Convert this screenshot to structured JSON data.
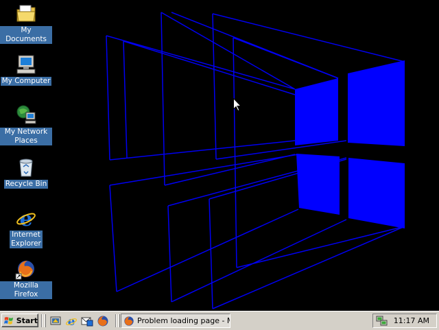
{
  "desktop": {
    "icons": [
      {
        "label": "My Documents",
        "icon": "my-documents-icon"
      },
      {
        "label": "My Computer",
        "icon": "my-computer-icon"
      },
      {
        "label": "My Network Places",
        "icon": "network-places-icon"
      },
      {
        "label": "Recycle Bin",
        "icon": "recycle-bin-icon"
      },
      {
        "label": "Internet Explorer",
        "icon": "internet-explorer-icon"
      },
      {
        "label": "Mozilla Firefox",
        "icon": "firefox-icon"
      }
    ],
    "wallpaper_color": "#0000ff"
  },
  "taskbar": {
    "start_label": "Start",
    "quick_launch": [
      "show-desktop-icon",
      "internet-explorer-icon",
      "outlook-express-icon",
      "firefox-icon"
    ],
    "tasks": [
      {
        "label": "Problem loading page - M...",
        "icon": "firefox-icon"
      }
    ],
    "tray": {
      "clock": "11:17 AM",
      "icons": [
        "network-tray-icon"
      ]
    }
  },
  "colors": {
    "taskbar": "#d4d0c8",
    "icon_label_bg": "#3b6ea5",
    "desktop": "#000000"
  }
}
